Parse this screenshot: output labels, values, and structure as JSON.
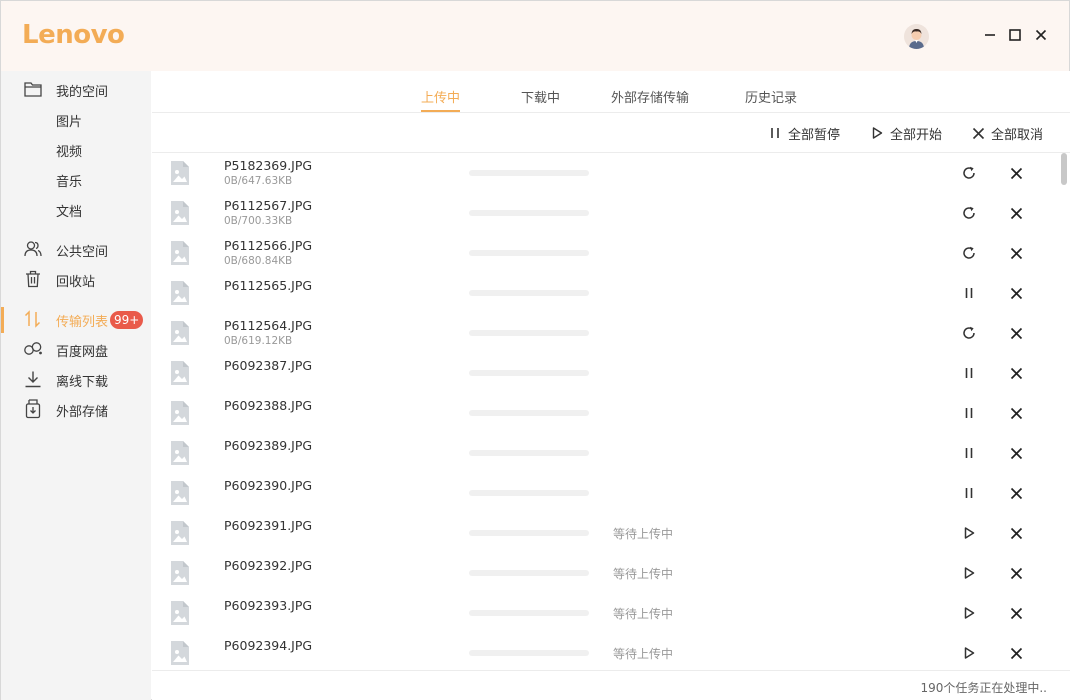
{
  "app": {
    "logo": "Lenovo"
  },
  "sidebar": {
    "items": [
      {
        "label": "我的空间",
        "icon": "folder-icon"
      },
      {
        "label": "图片"
      },
      {
        "label": "视频"
      },
      {
        "label": "音乐"
      },
      {
        "label": "文档"
      },
      {
        "label": "公共空间",
        "icon": "users-icon"
      },
      {
        "label": "回收站",
        "icon": "trash-icon"
      },
      {
        "label": "传输列表",
        "icon": "transfer-icon",
        "badge": "99+",
        "active": true
      },
      {
        "label": "百度网盘",
        "icon": "baidu-cloud-icon"
      },
      {
        "label": "离线下载",
        "icon": "download-icon"
      },
      {
        "label": "外部存储",
        "icon": "external-storage-icon"
      }
    ]
  },
  "tabs": [
    {
      "label": "上传中",
      "active": true
    },
    {
      "label": "下载中"
    },
    {
      "label": "外部存储传输"
    },
    {
      "label": "历史记录"
    }
  ],
  "toolbar": {
    "pause_all": "全部暂停",
    "start_all": "全部开始",
    "cancel_all": "全部取消"
  },
  "files": [
    {
      "name": "P5182369.JPG",
      "size": "0B/647.63KB",
      "status": "",
      "action": "retry",
      "progress": 0
    },
    {
      "name": "P6112567.JPG",
      "size": "0B/700.33KB",
      "status": "",
      "action": "retry",
      "progress": 0
    },
    {
      "name": "P6112566.JPG",
      "size": "0B/680.84KB",
      "status": "",
      "action": "retry",
      "progress": 0
    },
    {
      "name": "P6112565.JPG",
      "size": "",
      "status": "",
      "action": "pause",
      "progress": 0
    },
    {
      "name": "P6112564.JPG",
      "size": "0B/619.12KB",
      "status": "",
      "action": "retry",
      "progress": 0
    },
    {
      "name": "P6092387.JPG",
      "size": "",
      "status": "",
      "action": "pause",
      "progress": 0
    },
    {
      "name": "P6092388.JPG",
      "size": "",
      "status": "",
      "action": "pause",
      "progress": 0
    },
    {
      "name": "P6092389.JPG",
      "size": "",
      "status": "",
      "action": "pause",
      "progress": 0
    },
    {
      "name": "P6092390.JPG",
      "size": "",
      "status": "",
      "action": "pause",
      "progress": 0
    },
    {
      "name": "P6092391.JPG",
      "size": "",
      "status": "等待上传中",
      "action": "play",
      "progress": 0
    },
    {
      "name": "P6092392.JPG",
      "size": "",
      "status": "等待上传中",
      "action": "play",
      "progress": 0
    },
    {
      "name": "P6092393.JPG",
      "size": "",
      "status": "等待上传中",
      "action": "play",
      "progress": 0
    },
    {
      "name": "P6092394.JPG",
      "size": "",
      "status": "等待上传中",
      "action": "play",
      "progress": 0
    }
  ],
  "footer": {
    "text": "190个任务正在处理中.."
  },
  "colors": {
    "accent": "#f3ac56",
    "badge": "#e95a4a",
    "sidebar_bg": "#f4f4f4",
    "titlebar_bg": "#fdf6f2"
  }
}
